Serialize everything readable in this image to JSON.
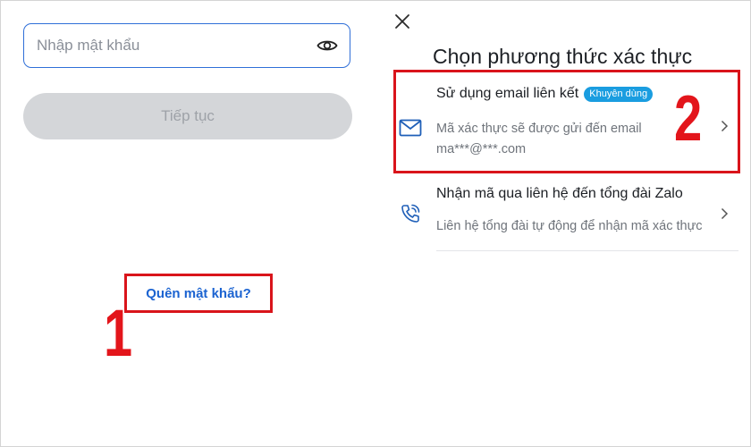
{
  "login": {
    "password_placeholder": "Nhập mật khẩu",
    "continue_label": "Tiếp tục",
    "forgot_label": "Quên mật khẩu?"
  },
  "annotations": {
    "step1": "1",
    "step2": "2",
    "highlight_color": "#d9141b"
  },
  "verify": {
    "title": "Chọn phương thức xác thực",
    "options": [
      {
        "title": "Sử dụng email liên kết",
        "badge": "Khuyên dùng",
        "desc_line1": "Mã xác thực sẽ được gửi đến email",
        "desc_line2": "ma***@***.com",
        "icon": "mail-icon"
      },
      {
        "title": "Nhận mã qua liên hệ đến tổng đài Zalo",
        "desc_line1": "Liên hệ tổng đài tự động để nhận mã xác thực",
        "icon": "phone-call-icon"
      }
    ]
  },
  "colors": {
    "accent": "#2f6fd8",
    "link": "#1b63d1",
    "badge": "#1a9de0",
    "button_disabled": "#d4d6d9"
  }
}
